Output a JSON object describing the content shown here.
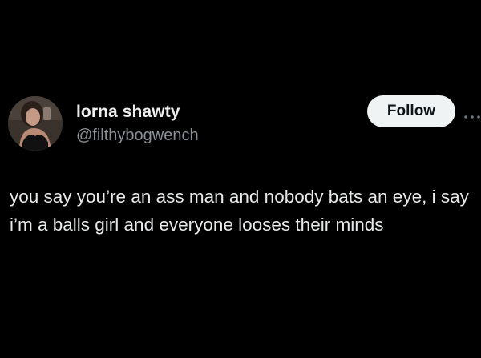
{
  "author": {
    "display_name": "lorna shawty",
    "handle": "@filthybogwench"
  },
  "actions": {
    "follow_label": "Follow",
    "more_icon": "more-dots-icon"
  },
  "tweet": {
    "text": "you say you’re an ass man and nobody bats an eye, i say i’m a balls girl and everyone looses their minds"
  },
  "colors": {
    "background": "#000000",
    "text": "#e7e9ea",
    "handle": "#8b9096",
    "follow_bg": "#eff3f4"
  }
}
